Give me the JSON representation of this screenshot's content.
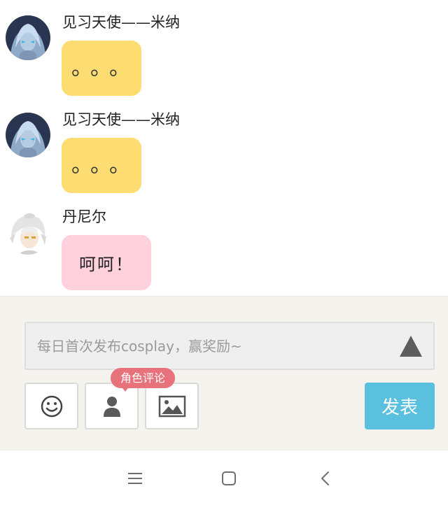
{
  "messages": [
    {
      "sender": "见习天使——米纳",
      "text": "。。。",
      "avatar": "angel-avatar",
      "bubble_color": "#fddc72"
    },
    {
      "sender": "见习天使——米纳",
      "text": "。。。",
      "avatar": "angel-avatar",
      "bubble_color": "#fddc72"
    },
    {
      "sender": "丹尼尔",
      "text": "呵呵！",
      "avatar": "daniel-avatar",
      "bubble_color": "#ffd1dc"
    }
  ],
  "composer": {
    "placeholder": "每日首次发布cosplay，赢奖励~",
    "send_icon": "triangle-up-icon",
    "tools": {
      "emoji_icon": "smiley-icon",
      "role_icon": "person-icon",
      "image_icon": "image-icon",
      "role_badge": "角色评论"
    },
    "post_label": "发表"
  },
  "navbar": {
    "menu_icon": "menu-icon",
    "home_icon": "home-square-icon",
    "back_icon": "back-chevron-icon"
  },
  "colors": {
    "accent": "#5bc0de",
    "badge": "#e8727c",
    "composer_bg": "#f4f3ee",
    "yellow_bubble": "#fddc72",
    "pink_bubble": "#ffd1dc"
  }
}
